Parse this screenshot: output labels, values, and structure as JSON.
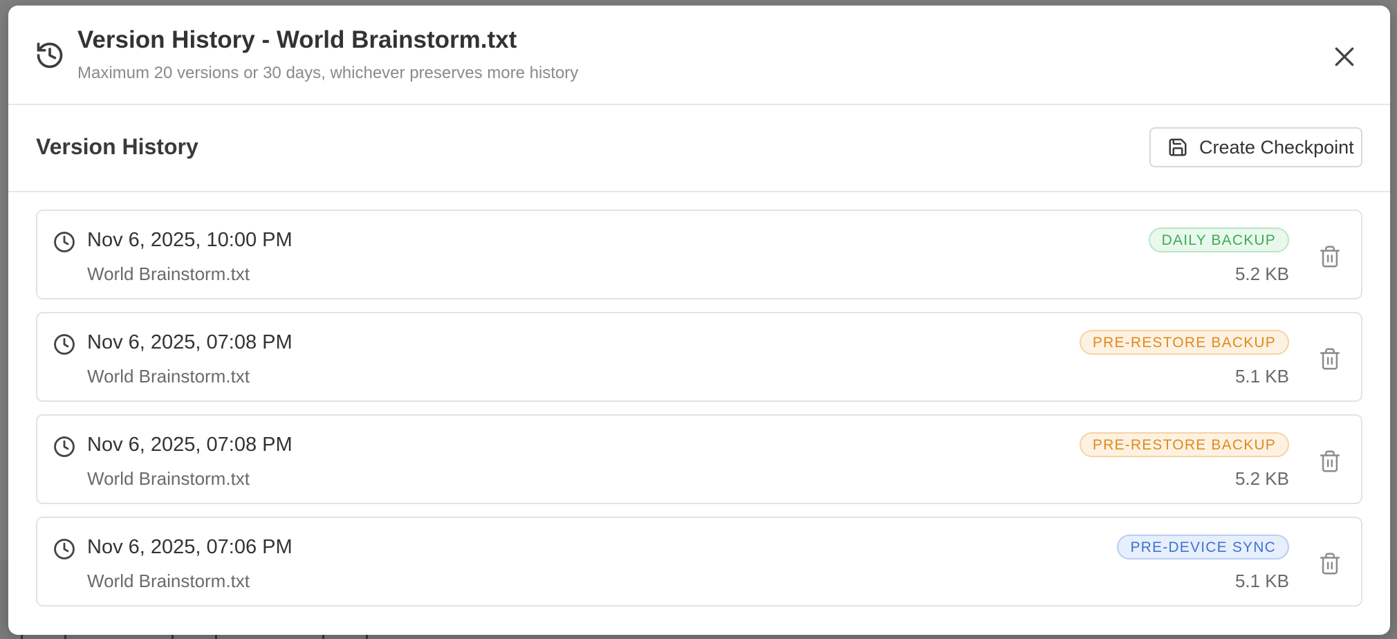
{
  "header": {
    "title": "Version History - World Brainstorm.txt",
    "subtitle": "Maximum 20 versions or 30 days, whichever preserves more history",
    "icon": "history-icon",
    "close_icon": "close-icon"
  },
  "section": {
    "title": "Version History",
    "checkpoint_label": "Create Checkpoint",
    "checkpoint_icon": "save-icon"
  },
  "versions": [
    {
      "timestamp": "Nov 6, 2025, 10:00 PM",
      "filename": "World Brainstorm.txt",
      "badge": "DAILY BACKUP",
      "badge_kind": "daily",
      "size": "5.2 KB"
    },
    {
      "timestamp": "Nov 6, 2025, 07:08 PM",
      "filename": "World Brainstorm.txt",
      "badge": "PRE-RESTORE BACKUP",
      "badge_kind": "prerestore",
      "size": "5.1 KB"
    },
    {
      "timestamp": "Nov 6, 2025, 07:08 PM",
      "filename": "World Brainstorm.txt",
      "badge": "PRE-RESTORE BACKUP",
      "badge_kind": "prerestore",
      "size": "5.2 KB"
    },
    {
      "timestamp": "Nov 6, 2025, 07:06 PM",
      "filename": "World Brainstorm.txt",
      "badge": "PRE-DEVICE SYNC",
      "badge_kind": "predevice",
      "size": "5.1 KB"
    }
  ],
  "colors": {
    "daily": "#3fab55",
    "prerestore": "#e08a1b",
    "predevice": "#3c73d4"
  }
}
